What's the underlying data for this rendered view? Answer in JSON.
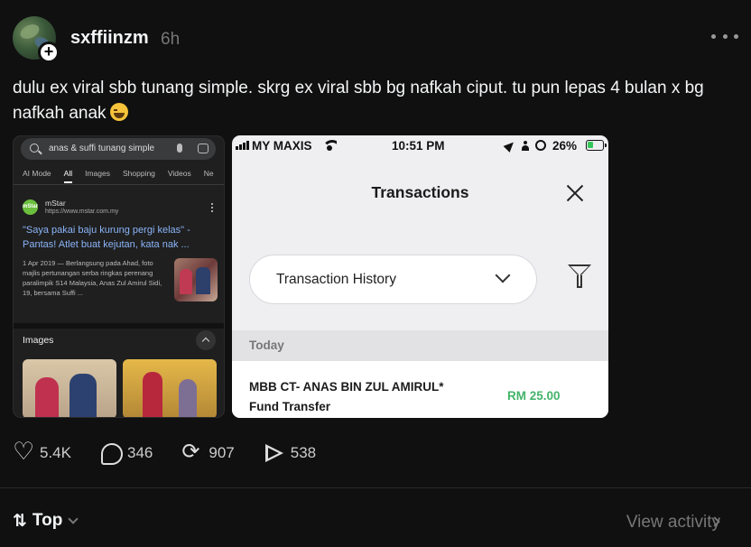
{
  "post": {
    "username": "sxffiinzm",
    "time": "6h",
    "caption": "dulu ex viral sbb tunang simple. skrg ex viral sbb bg nafkah ciput. tu pun lepas 4 bulan x bg nafkah anak",
    "caption_emoji": "face-with-tears-of-joy-emoji"
  },
  "google_screenshot": {
    "search_query": "anas & suffi tunang simple",
    "tabs": [
      "AI Mode",
      "All",
      "Images",
      "Shopping",
      "Videos",
      "Ne"
    ],
    "active_tab": "All",
    "result": {
      "site_logo_text": "mStar",
      "site_name": "mStar",
      "site_url": "https://www.mstar.com.my",
      "title": "\"Saya pakai baju kurung pergi kelas\" - Pantas! Atlet buat kejutan, kata nak ...",
      "snippet": "1 Apr 2019 — Berlangsung pada Ahad, foto majlis pertunangan serba ringkas perenang paralimpik S14 Malaysia, Anas Zul Amirul Sidi, 19, bersama Suffi ..."
    },
    "images_section_label": "Images"
  },
  "bank_screenshot": {
    "status": {
      "carrier": "MY MAXIS",
      "time": "10:51 PM",
      "battery": "26%"
    },
    "title": "Transactions",
    "dropdown_value": "Transaction History",
    "section_label": "Today",
    "transaction": {
      "name": "MBB CT- ANAS BIN ZUL AMIRUL*",
      "type": "Fund Transfer",
      "amount": "RM 25.00"
    },
    "colors": {
      "amount": "#43b36a",
      "background": "#efeff1"
    }
  },
  "actions": {
    "likes": "5.4K",
    "comments": "346",
    "reposts": "907",
    "shares": "538"
  },
  "footer": {
    "sort_label": "Top",
    "view_activity": "View activity"
  }
}
